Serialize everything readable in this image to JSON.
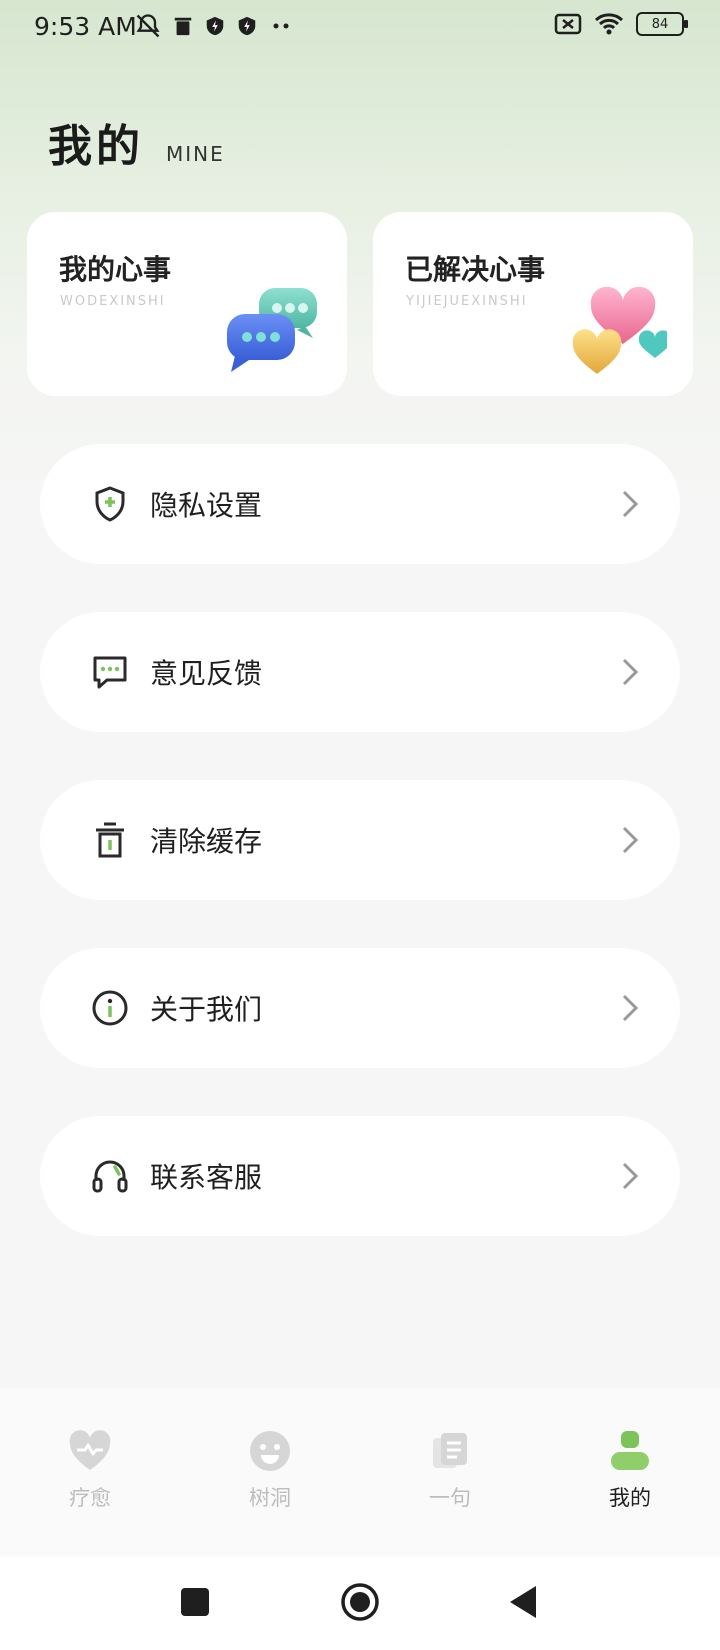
{
  "status_bar": {
    "time": "9:53 AM",
    "battery": "84",
    "icons_left": [
      "notifications-off-icon",
      "trash-icon",
      "shield-icon",
      "shield-icon",
      "more-dots-icon"
    ],
    "icons_right": [
      "no-sim-icon",
      "wifi-icon",
      "battery-icon"
    ]
  },
  "header": {
    "title": "我的",
    "subtitle": "MINE"
  },
  "cards": [
    {
      "title": "我的心事",
      "subtitle": "WODEXINSHI",
      "icon": "chat-bubbles-icon"
    },
    {
      "title": "已解决心事",
      "subtitle": "YIJIEJUEXINSHI",
      "icon": "hearts-icon"
    }
  ],
  "menu": [
    {
      "label": "隐私设置",
      "icon": "shield-plus-icon"
    },
    {
      "label": "意见反馈",
      "icon": "feedback-icon"
    },
    {
      "label": "清除缓存",
      "icon": "trash-icon"
    },
    {
      "label": "关于我们",
      "icon": "info-icon"
    },
    {
      "label": "联系客服",
      "icon": "headset-icon"
    }
  ],
  "tabs": [
    {
      "label": "疗愈",
      "icon": "heart-pulse-icon",
      "active": false
    },
    {
      "label": "树洞",
      "icon": "smile-icon",
      "active": false
    },
    {
      "label": "一句",
      "icon": "notes-icon",
      "active": false
    },
    {
      "label": "我的",
      "icon": "user-icon",
      "active": true
    }
  ],
  "colors": {
    "accent_green": "#7cc35a",
    "active_tab": "#8fce6b",
    "inactive_tab": "#d6d6d6",
    "chevron": "#999999"
  }
}
